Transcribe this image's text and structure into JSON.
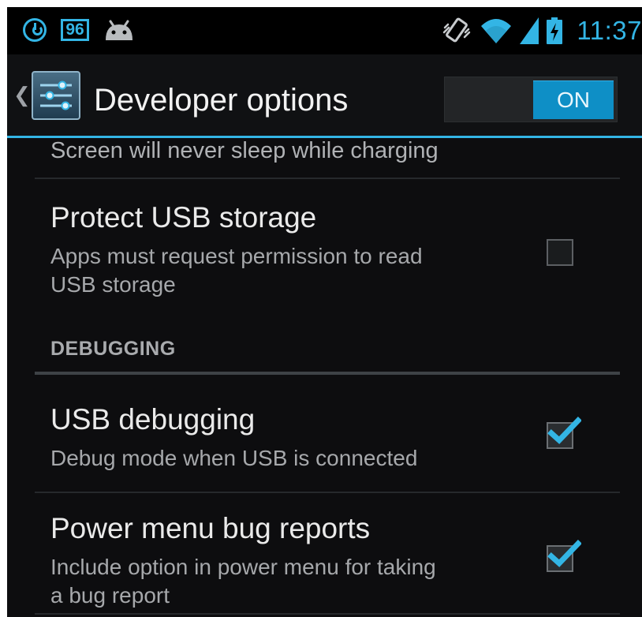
{
  "status_bar": {
    "notification_badge": "96",
    "time": "11:37",
    "icons": [
      "power-icon",
      "badge-96-icon",
      "android-icon",
      "vibrate-icon",
      "wifi-icon",
      "signal-icon",
      "battery-charging-icon"
    ],
    "accent_color": "#33b5e5"
  },
  "action_bar": {
    "title": "Developer options",
    "master_switch": {
      "label": "ON",
      "state": "on"
    },
    "icons": [
      "up-caret-icon",
      "settings-sliders-icon"
    ]
  },
  "settings": [
    {
      "id": "stay-awake",
      "summary": "Screen will never sleep while charging",
      "partially_visible": true
    },
    {
      "id": "protect-usb-storage",
      "title": "Protect USB storage",
      "summary_line1": "Apps must request permission to read",
      "summary_line2": "USB storage",
      "checked": false
    },
    {
      "id": "debugging-header",
      "section_header": "DEBUGGING"
    },
    {
      "id": "usb-debugging",
      "title": "USB debugging",
      "summary": "Debug mode when USB is connected",
      "checked": true
    },
    {
      "id": "power-menu-bug-reports",
      "title": "Power menu bug reports",
      "summary_line1": "Include option in power menu for taking",
      "summary_line2": "a bug report",
      "checked": true
    }
  ]
}
